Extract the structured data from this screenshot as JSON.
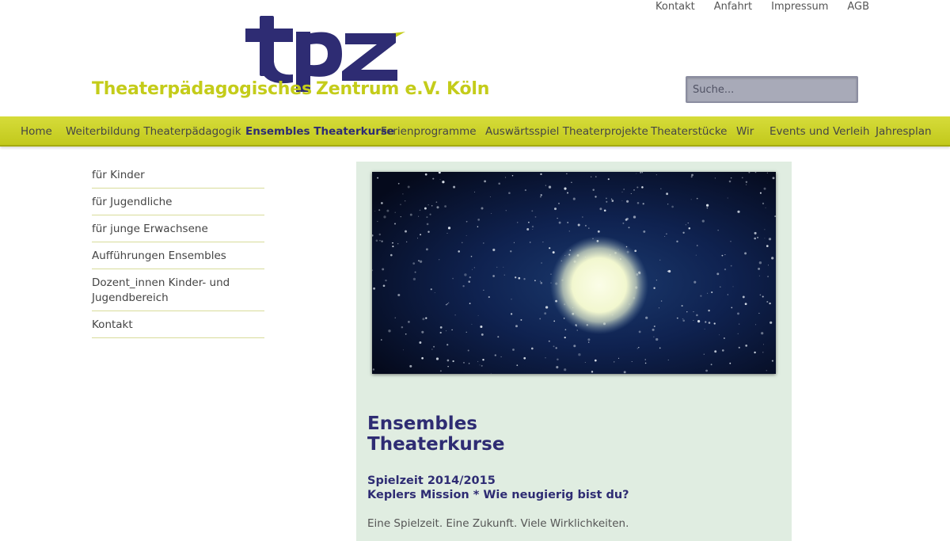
{
  "top_links": [
    "Kontakt",
    "Anfahrt",
    "Impressum",
    "AGB"
  ],
  "logo": {
    "mark": "tpz",
    "tagline_left": "Theaterpädagogisches",
    "tagline_right": "Zentrum e.V. Köln"
  },
  "search": {
    "placeholder": "Suche..."
  },
  "nav": [
    "Home",
    "Weiterbildung Theaterpädagogik",
    "Ensembles Theaterkurse",
    "Ferienprogramme",
    "Auswärtsspiel Theaterprojekte",
    "Theaterstücke",
    "Wir",
    "Events und Verleih",
    "Jahresplan"
  ],
  "nav_active": "Ensembles Theaterkurse",
  "sidebar": [
    "für Kinder",
    "für Jugendliche",
    "für junge Erwachsene",
    "Aufführungen Ensembles",
    "Dozent_innen Kinder- und Jugendbereich",
    "Kontakt"
  ],
  "content": {
    "title": "Ensembles Theaterkurse",
    "subtitle_line1": "Spielzeit 2014/2015",
    "subtitle_line2": "Keplers Mission * Wie neugierig bist du?",
    "text": "Eine Spielzeit. Eine Zukunft. Viele Wirklichkeiten."
  },
  "colors": {
    "brand_navy": "#2e2c73",
    "brand_lime": "#c4cc1a",
    "content_bg": "#e0ede1"
  }
}
